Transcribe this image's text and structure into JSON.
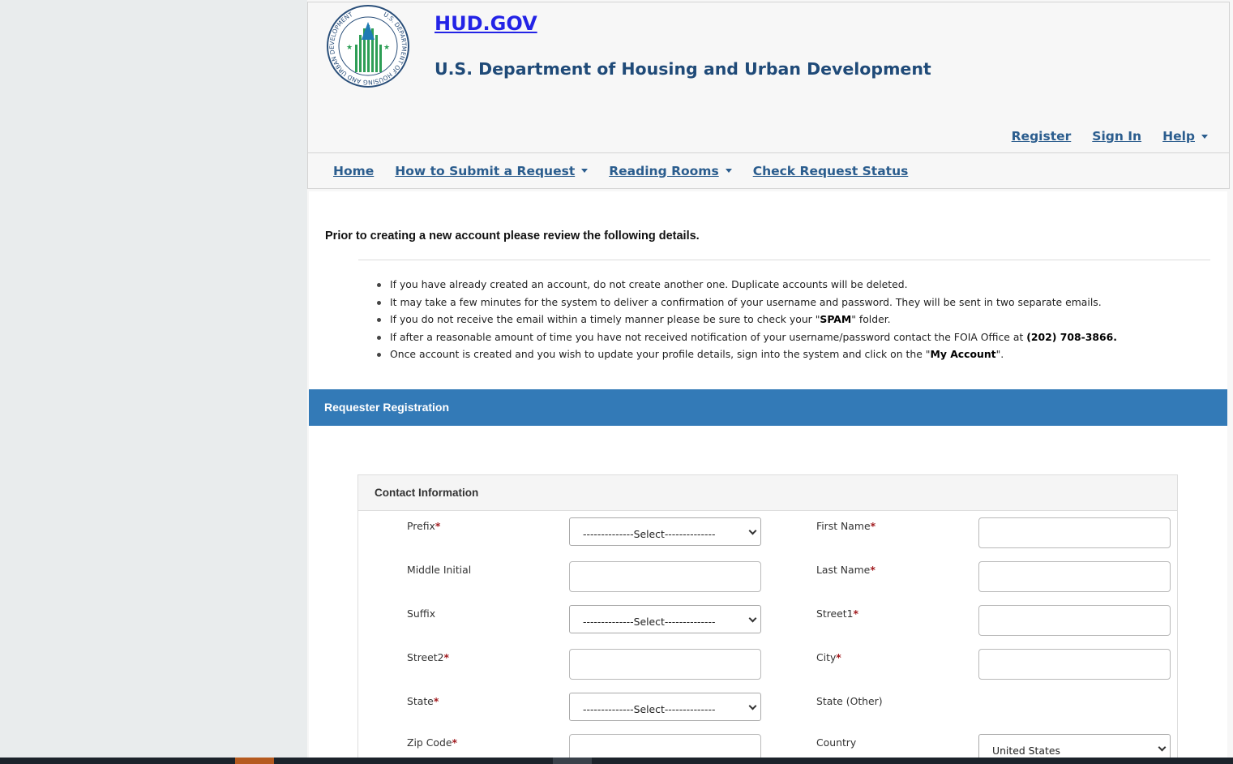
{
  "header": {
    "site_link": "HUD.GOV",
    "agency_name": "U.S. Department of Housing and Urban Development",
    "seal_text": "U.S. DEPARTMENT OF HOUSING AND URBAN DEVELOPMENT"
  },
  "util_nav": {
    "register": "Register",
    "sign_in": "Sign In",
    "help": "Help"
  },
  "main_nav": {
    "home": "Home",
    "how_to_submit": "How to Submit a Request",
    "reading_rooms": "Reading Rooms",
    "check_status": "Check Request Status"
  },
  "intro": "Prior to creating a new account please review the following details.",
  "notes": {
    "n1": "If you have already created an account, do not create another one. Duplicate accounts will be deleted.",
    "n2": "It may take a few minutes for the system to deliver a confirmation of your username and password. They will be sent in two separate emails.",
    "n3_pre": "If you do not receive the email within a timely manner please be sure to check your \"",
    "n3_bold": "SPAM",
    "n3_post": "\" folder.",
    "n4_pre": "If after a reasonable amount of time you have not received notification of your username/password contact the FOIA Office at ",
    "n4_bold": "(202) 708-3866.",
    "n5_pre": "Once account is created and you wish to update your profile details, sign into the system and click on the \"",
    "n5_bold": "My Account",
    "n5_post": "\"."
  },
  "registration": {
    "bar_title": "Requester Registration",
    "panel_title": "Contact Information",
    "required_mark": "*",
    "select_placeholder": "--------------Select--------------",
    "fields": {
      "prefix": "Prefix",
      "first_name": "First Name",
      "middle_initial": "Middle Initial",
      "last_name": "Last Name",
      "suffix": "Suffix",
      "street1": "Street1",
      "street2": "Street2",
      "city": "City",
      "state": "State",
      "state_other": "State (Other)",
      "zip_code": "Zip Code",
      "country": "Country"
    },
    "country_value": "United States"
  },
  "colors": {
    "brand_blue": "#337ab7",
    "link": "#2b5d8e",
    "site_link": "#2323e6",
    "seal_green": "#2e9e56",
    "seal_blue": "#1f7ab5"
  }
}
